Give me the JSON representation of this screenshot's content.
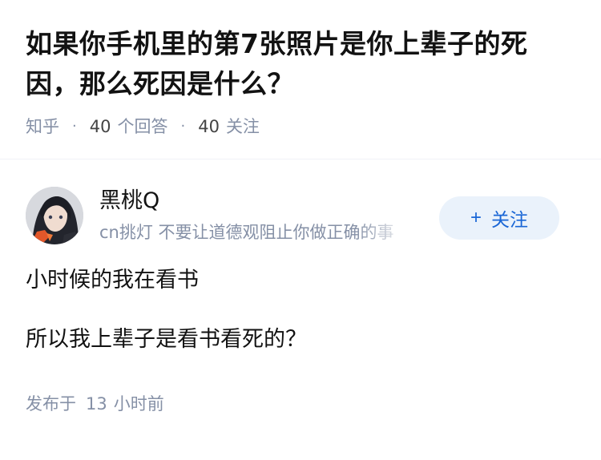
{
  "question": {
    "title": "如果你手机里的第7张照片是你上辈子的死因，那么死因是什么？",
    "source": "知乎",
    "answer_count": "40",
    "answer_label": "个回答",
    "follow_count": "40",
    "follow_label": "关注"
  },
  "author": {
    "name": "黑桃Q",
    "bio": "cn挑灯 不要让道德观阻止你做正确的事",
    "follow_button": "关注",
    "follow_icon": "plus-icon"
  },
  "answer": {
    "paragraphs": [
      "小时候的我在看书",
      "所以我上辈子是看书看死的？"
    ]
  },
  "publish": {
    "prefix": "发布于",
    "time_value": "13",
    "time_unit": "小时前"
  },
  "colors": {
    "primary_text": "#121212",
    "meta_text": "#8590a6",
    "follow_bg": "#eaf2fb",
    "follow_text": "#1a66d6"
  }
}
